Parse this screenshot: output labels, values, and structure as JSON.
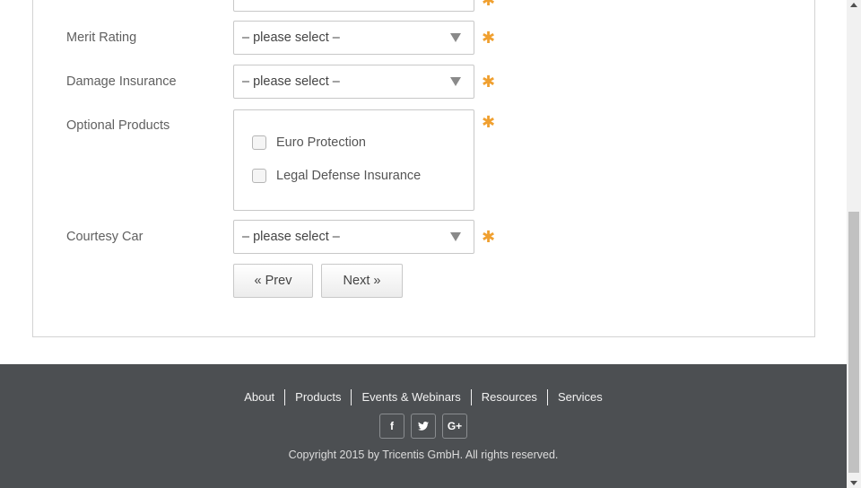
{
  "form": {
    "fields": [
      {
        "label": "Merit Rating",
        "value": "– please select –"
      },
      {
        "label": "Damage Insurance",
        "value": "– please select –"
      },
      {
        "label": "Optional Products"
      },
      {
        "label": "Courtesy Car",
        "value": "– please select –"
      }
    ],
    "optional_products": {
      "options": [
        {
          "label": "Euro Protection",
          "checked": false
        },
        {
          "label": "Legal Defense Insurance",
          "checked": false
        }
      ]
    },
    "required_marker": "✱",
    "prev_label": "« Prev",
    "next_label": "Next »"
  },
  "footer": {
    "links": [
      "About",
      "Products",
      "Events & Webinars",
      "Resources",
      "Services"
    ],
    "social": [
      {
        "icon": "facebook-icon",
        "glyph": "f"
      },
      {
        "icon": "twitter-icon",
        "glyph": "🐦"
      },
      {
        "icon": "google-plus-icon",
        "glyph": "G+"
      }
    ],
    "copyright": "Copyright 2015 by Tricentis GmbH. All rights reserved."
  },
  "colors": {
    "required": "#f0a030",
    "footer_bg": "#4c4f52"
  }
}
